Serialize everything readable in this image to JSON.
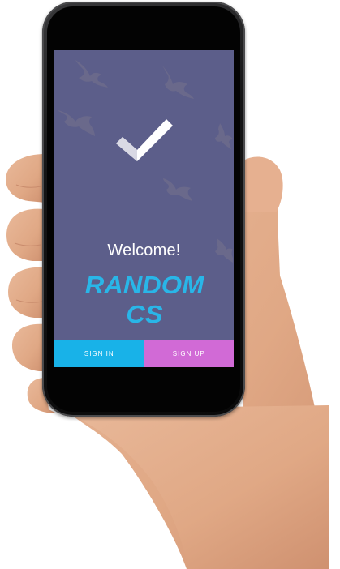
{
  "screen": {
    "welcome_text": "Welcome!",
    "brand_name": "RANDOM CS",
    "background_color": "#5c5e8a",
    "check_icon": "checkmark-icon"
  },
  "buttons": {
    "sign_in_label": "SIGN IN",
    "sign_up_label": "SIGN UP",
    "sign_in_color": "#18b2e8",
    "sign_up_color": "#d16ad6"
  },
  "decor": {
    "bird_icon": "bird-icon"
  }
}
